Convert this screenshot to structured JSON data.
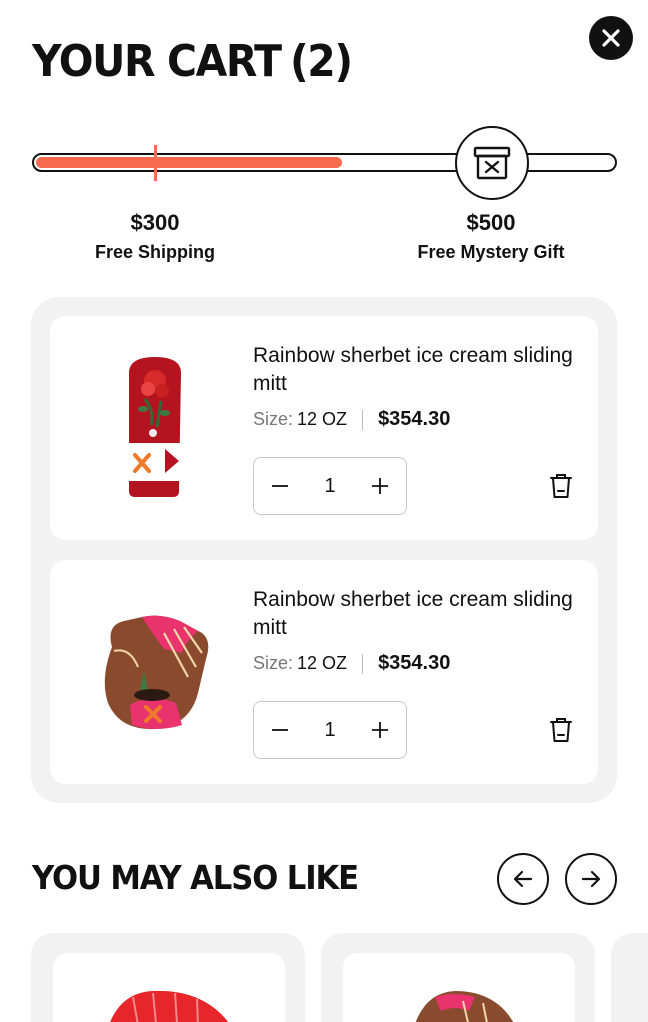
{
  "header": {
    "title": "YOUR CART",
    "count": "(2)"
  },
  "progress": {
    "fill_fraction": 0.53,
    "milestones": [
      {
        "amount": "$300",
        "label": "Free Shipping"
      },
      {
        "amount": "$500",
        "label": "Free Mystery Gift"
      }
    ]
  },
  "cart": {
    "items": [
      {
        "name": "Rainbow sherbet ice cream sliding mitt",
        "size_label": "Size:",
        "size": "12 OZ",
        "price": "$354.30",
        "quantity": "1"
      },
      {
        "name": "Rainbow sherbet ice cream sliding mitt",
        "size_label": "Size:",
        "size": "12 OZ",
        "price": "$354.30",
        "quantity": "1"
      }
    ]
  },
  "recommendations": {
    "title": "YOU MAY ALSO LIKE"
  },
  "colors": {
    "accent": "#f86b4e",
    "text": "#111111",
    "panel": "#f2f2f2"
  },
  "icons": [
    "close-icon",
    "gift-box-icon",
    "minus-icon",
    "plus-icon",
    "trash-icon",
    "arrow-left-icon",
    "arrow-right-icon"
  ]
}
